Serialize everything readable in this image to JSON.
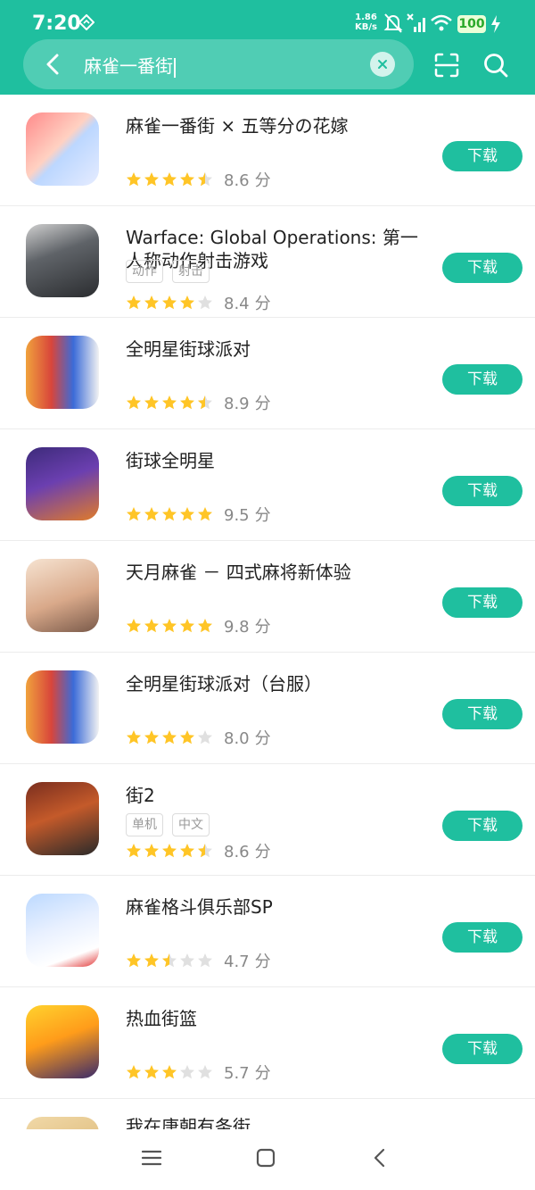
{
  "status_bar": {
    "time": "7:20",
    "net_speed": "1.86",
    "net_unit": "KB/s",
    "battery": "100"
  },
  "search": {
    "query": "麻雀一番街"
  },
  "download_label": "下载",
  "score_unit": "分",
  "colors": {
    "accent": "#1fbf9f",
    "star": "#ffc526",
    "star_empty": "#e0e0e0"
  },
  "results": [
    {
      "name": "麻雀一番街 × 五等分の花嫁",
      "tags": [],
      "stars": 4.5,
      "score": "8.6"
    },
    {
      "name": "Warface: Global Operations: 第一人称动作射击游戏",
      "tags": [
        "动作",
        "射击"
      ],
      "stars": 4,
      "score": "8.4"
    },
    {
      "name": "全明星街球派对",
      "tags": [],
      "stars": 4.5,
      "score": "8.9"
    },
    {
      "name": "街球全明星",
      "tags": [],
      "stars": 5,
      "score": "9.5"
    },
    {
      "name": "天月麻雀 － 四式麻将新体验",
      "tags": [],
      "stars": 5,
      "score": "9.8"
    },
    {
      "name": "全明星街球派对（台服）",
      "tags": [],
      "stars": 4,
      "score": "8.0"
    },
    {
      "name": "街2",
      "tags": [
        "单机",
        "中文"
      ],
      "stars": 4.5,
      "score": "8.6"
    },
    {
      "name": "麻雀格斗俱乐部SP",
      "tags": [],
      "stars": 2.5,
      "score": "4.7"
    },
    {
      "name": "热血街篮",
      "tags": [],
      "stars": 3,
      "score": "5.7"
    },
    {
      "name": "我在唐朝有条街",
      "tags": [],
      "stars": null,
      "score": null
    }
  ]
}
